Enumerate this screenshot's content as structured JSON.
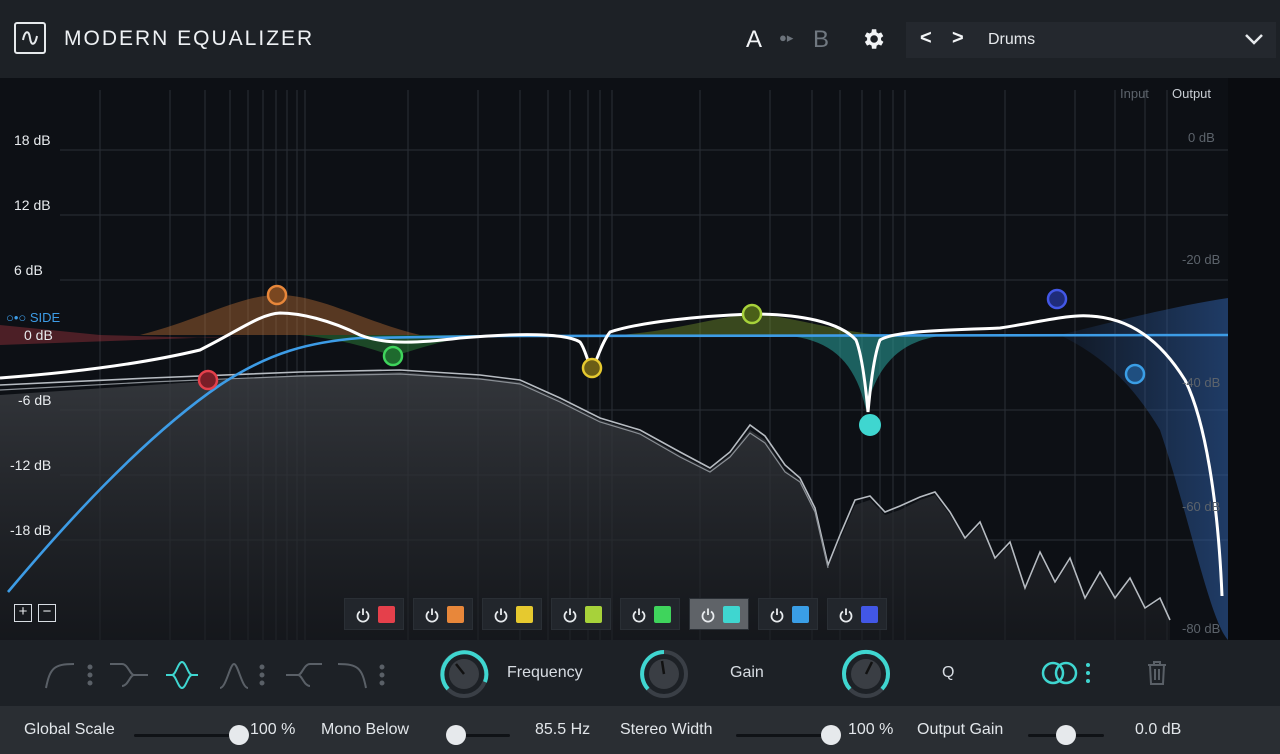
{
  "header": {
    "title": "MODERN EQUALIZER",
    "ab_a": "A",
    "ab_b": "B",
    "preset": "Drums"
  },
  "graph": {
    "db_left": [
      "18 dB",
      "12 dB",
      "6 dB",
      "0 dB",
      "-6 dB",
      "-12 dB",
      "-18 dB"
    ],
    "db_right": [
      "0 dB",
      "-20 dB",
      "-40 dB",
      "-60 dB",
      "-80 dB"
    ],
    "input_label": "Input",
    "output_label": "Output",
    "side_label": "SIDE"
  },
  "bands": [
    {
      "color": "#e5404b"
    },
    {
      "color": "#e8873a"
    },
    {
      "color": "#e6c92f"
    },
    {
      "color": "#a7d23a"
    },
    {
      "color": "#3fd45c"
    },
    {
      "color": "#3fd6d0",
      "active": true
    },
    {
      "color": "#3a9ee6"
    },
    {
      "color": "#4257e6"
    }
  ],
  "controls": {
    "frequency": "Frequency",
    "gain": "Gain",
    "q": "Q"
  },
  "footer": {
    "global_scale_label": "Global Scale",
    "global_scale_value": "100 %",
    "global_scale_level": 0.95,
    "mono_below_label": "Mono Below",
    "mono_below_value": "85.5 Hz",
    "mono_below_level": 0.1,
    "stereo_width_label": "Stereo Width",
    "stereo_width_value": "100 %",
    "stereo_width_level": 0.95,
    "output_gain_label": "Output Gain",
    "output_gain_value": "0.0 dB",
    "output_gain_level": 0.5
  },
  "colors": {
    "accent": "#3fd6d0",
    "curve": "#ffffff",
    "side": "#3d9ce6"
  }
}
